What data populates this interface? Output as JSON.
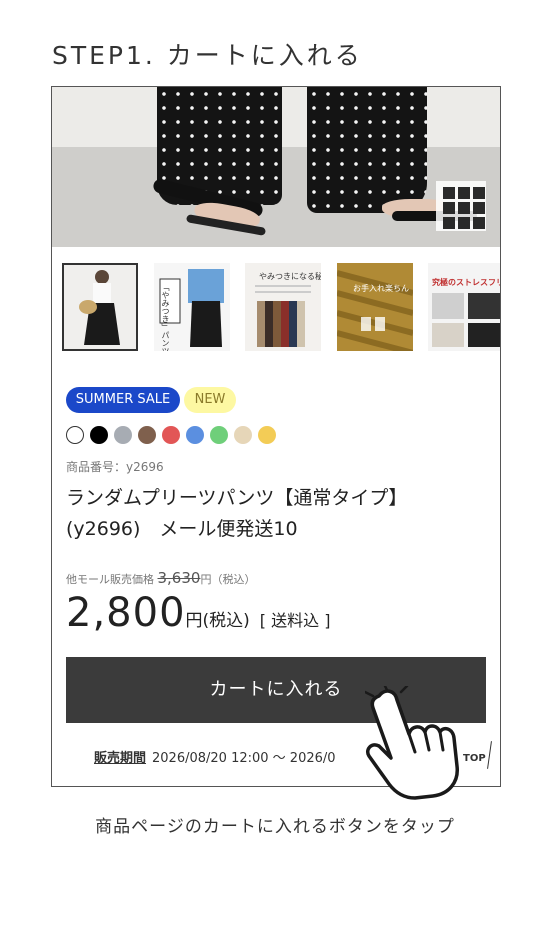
{
  "step_title": "STEP1. カートに入れる",
  "badges": {
    "sale": "SUMMER SALE",
    "new": "NEW"
  },
  "swatch_colors": [
    "#ffffff",
    "#000000",
    "#a7acb3",
    "#7f604d",
    "#e25656",
    "#5b8fe0",
    "#6fcf7a",
    "#e6d6b8",
    "#f3cc56"
  ],
  "product": {
    "code": "商品番号：y2696",
    "name_line1": "ランダムプリーツパンツ【通常タイプ】",
    "name_line2": "(y2696)　メール便発送10",
    "other_price_label": "他モール販売価格",
    "other_price": "3,630",
    "other_price_unit": "円（税込）",
    "price": "2,800",
    "price_unit": "円(税込)",
    "shipping": "[ 送料込 ]"
  },
  "thumbnails": {
    "t2_caption": "「やみつき」パンツ",
    "t3_caption": "やみつきになる秘密",
    "t4_caption": "お手入れ楽ちん",
    "t5_caption": "究極のストレスフリー!"
  },
  "cart_button": "カートに入れる",
  "sale_period_label": "販売期間",
  "sale_period_value": "2026/08/20 12:00 〜 2026/0",
  "top_link": "TOP",
  "caption": "商品ページのカートに入れるボタンをタップ",
  "icons": {
    "grid": "grid-view-icon",
    "hand": "tap-hand-icon"
  }
}
